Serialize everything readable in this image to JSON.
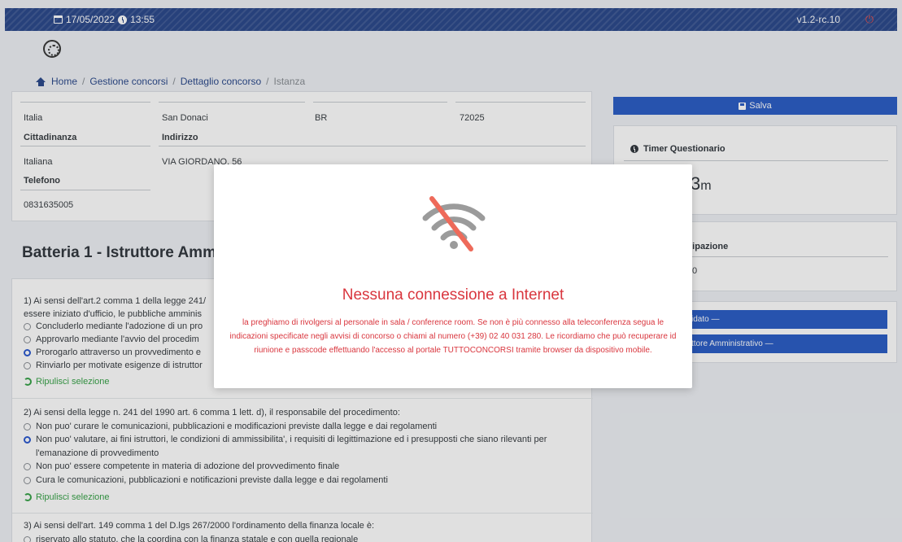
{
  "topbar": {
    "date": "17/05/2022",
    "time": "13:55",
    "version": "v1.2-rc.10"
  },
  "breadcrumb": {
    "home": "Home",
    "items": [
      "Gestione concorsi",
      "Dettaglio concorso",
      "Istanza"
    ]
  },
  "anagrafica": {
    "row1": {
      "nazione": "Italia",
      "comune": "San Donaci",
      "provincia": "BR",
      "cap": "72025"
    },
    "cittadinanza_label": "Cittadinanza",
    "cittadinanza_value": "Italiana",
    "indirizzo_label": "Indirizzo",
    "indirizzo_value": "VIA GIORDANO, 56",
    "telefono_label": "Telefono",
    "telefono_value": "0831635005"
  },
  "battery_title": "Batteria 1 - Istruttore Amm",
  "questions": [
    {
      "text": "1) Ai sensi dell'art.2 comma 1 della legge 241/",
      "text2": "essere iniziato d'ufficio, le pubbliche amminis",
      "options": [
        "Concluderlo mediante l'adozione di un pro",
        "Approvarlo mediante l'avvio del procedim",
        "Prorogarlo attraverso un provvedimento e",
        "Rinviarlo per motivate esigenze di istruttor"
      ],
      "clear": "Ripulisci selezione"
    },
    {
      "text": "2) Ai sensi della legge n. 241 del 1990 art. 6 comma 1 lett. d), il responsabile del procedimento:",
      "options": [
        "Non puo' curare le comunicazioni, pubblicazioni e modificazioni previste dalla legge e dai regolamenti",
        "Non puo' valutare, ai fini istruttori, le condizioni di ammissibilita', i requisiti di legittimazione ed i presupposti che siano rilevanti per",
        "l'emanazione di provvedimento",
        "Non puo' essere competente in materia di adozione del provvedimento finale",
        "Cura le comunicazioni, pubblicazioni e notificazioni previste dalla legge e dai regolamenti"
      ],
      "clear": "Ripulisci selezione"
    },
    {
      "text": "3) Ai sensi dell'art. 149 comma 1 del D.lgs 267/2000 l'ordinamento della finanza locale è:",
      "options": [
        "riservato allo statuto, che la coordina con la finanza statale e con quella regionale"
      ]
    }
  ],
  "right": {
    "save": "Salva",
    "timer_label": "Timer Questionario",
    "timer_value": "3",
    "timer_unit": "m",
    "partecipazione_label": "rtecipazione",
    "partecipazione_value": "0",
    "btn1": "idato —",
    "btn2": "ttore Amministrativo —"
  },
  "modal": {
    "title": "Nessuna connessione a Internet",
    "message": "la preghiamo di rivolgersi al personale in sala / conference room. Se non è più connesso alla teleconferenza segua le indicazioni specificate negli avvisi di concorso o chiami al numero (+39) 02 40 031 280. Le ricordiamo che può recuperare id riunione e passcode effettuando l'accesso al portale TUTTOCONCORSI tramite browser da dispositivo mobile."
  },
  "colors": {
    "topbar": "#2d4b8c",
    "primary": "#2d5fc6",
    "error": "#d9363e",
    "success": "#3aa34a"
  }
}
